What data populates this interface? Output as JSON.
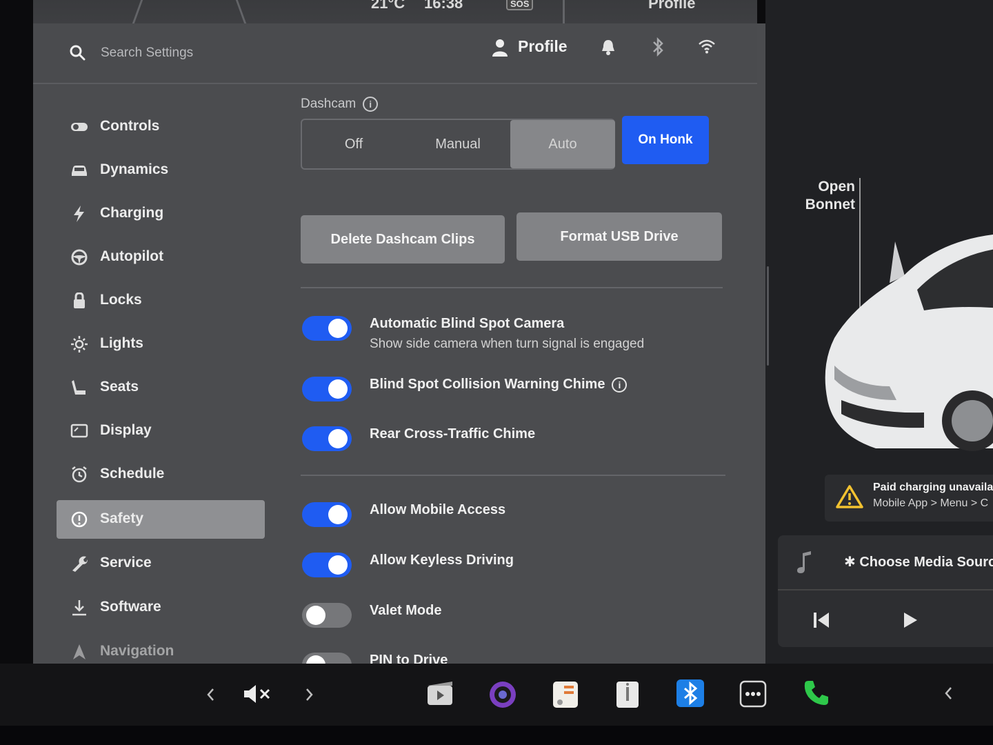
{
  "status": {
    "temperature": "21°C",
    "time": "16:38",
    "sos": "SOS",
    "profile_short": "Profile"
  },
  "header": {
    "search_placeholder": "Search Settings",
    "profile_label": "Profile",
    "icons": [
      "search-icon",
      "person-icon",
      "bell-icon",
      "bluetooth-icon",
      "wifi-icon"
    ]
  },
  "sidebar": {
    "items": [
      {
        "label": "Controls",
        "icon": "toggle-icon"
      },
      {
        "label": "Dynamics",
        "icon": "car-icon"
      },
      {
        "label": "Charging",
        "icon": "bolt-icon"
      },
      {
        "label": "Autopilot",
        "icon": "steering-wheel-icon"
      },
      {
        "label": "Locks",
        "icon": "lock-icon"
      },
      {
        "label": "Lights",
        "icon": "sun-icon"
      },
      {
        "label": "Seats",
        "icon": "seat-icon"
      },
      {
        "label": "Display",
        "icon": "display-icon"
      },
      {
        "label": "Schedule",
        "icon": "alarm-clock-icon"
      },
      {
        "label": "Safety",
        "icon": "alert-circle-icon",
        "active": true
      },
      {
        "label": "Service",
        "icon": "wrench-icon"
      },
      {
        "label": "Software",
        "icon": "download-icon"
      },
      {
        "label": "Navigation",
        "icon": "navigation-icon"
      }
    ]
  },
  "dashcam": {
    "title": "Dashcam",
    "options": [
      "Off",
      "Manual",
      "Auto"
    ],
    "selected": "Auto",
    "on_honk": "On Honk",
    "delete_clips": "Delete Dashcam Clips",
    "format_usb": "Format USB Drive"
  },
  "toggles": [
    {
      "label": "Automatic Blind Spot Camera",
      "sub": "Show side camera when turn signal is engaged",
      "on": true
    },
    {
      "label": "Blind Spot Collision Warning Chime",
      "on": true,
      "info": true
    },
    {
      "label": "Rear Cross-Traffic Chime",
      "on": true
    },
    {
      "label": "Allow Mobile Access",
      "on": true
    },
    {
      "label": "Allow Keyless Driving",
      "on": true
    },
    {
      "label": "Valet Mode",
      "on": false
    },
    {
      "label": "PIN to Drive",
      "on": false
    }
  ],
  "car_panel": {
    "open_bonnet": "Open Bonnet",
    "alert_title": "Paid charging unavaila",
    "alert_sub": "Mobile App > Menu > C",
    "media_source": "Choose Media Sourc",
    "media_icons": [
      "music-note-icon",
      "skip-previous-icon",
      "play-icon"
    ]
  },
  "dock": {
    "icons": [
      "chevron-left-icon",
      "speaker-muted-icon",
      "chevron-right-icon",
      "theater-icon",
      "camera-app-icon",
      "toybox-icon",
      "manual-icon",
      "bluetooth-app-icon",
      "more-icon",
      "phone-icon",
      "chevron-left-icon"
    ]
  },
  "colors": {
    "accent": "#1f5cf2",
    "panel": "#4b4c4f",
    "warning": "#f2c230",
    "phone": "#2ec84a"
  }
}
